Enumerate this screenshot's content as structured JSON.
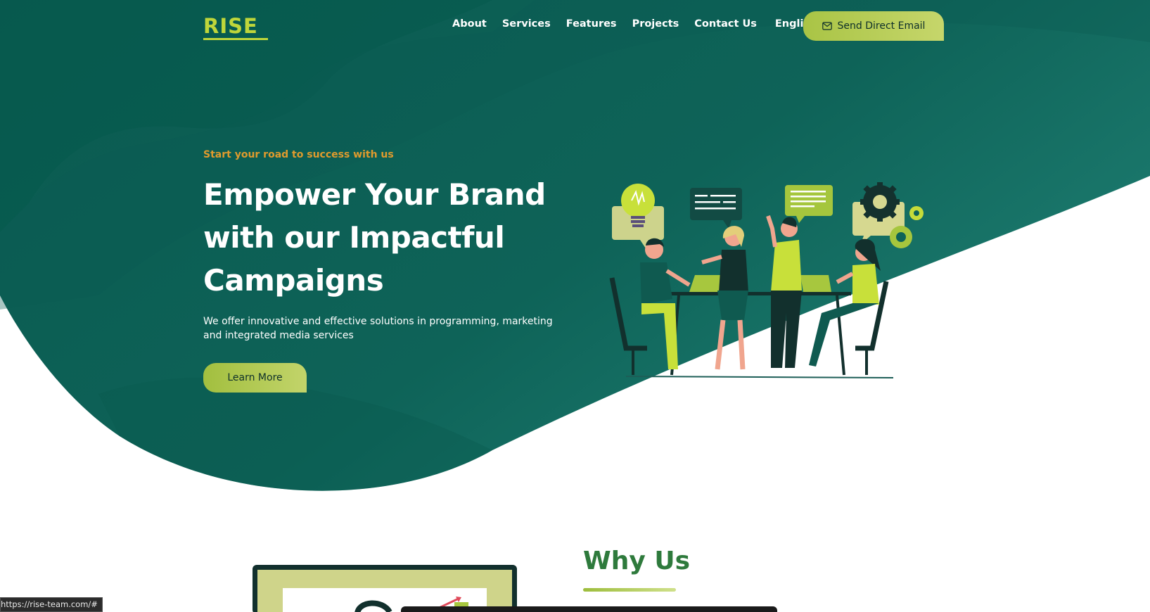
{
  "brand": {
    "logo_text": "RISE"
  },
  "nav": {
    "items": [
      {
        "label": "About"
      },
      {
        "label": "Services"
      },
      {
        "label": "Features"
      },
      {
        "label": "Projects"
      },
      {
        "label": "Contact Us"
      }
    ],
    "language": "English",
    "email_button": "Send Direct Email"
  },
  "hero": {
    "tagline": "Start your road to success with us",
    "headline_line1": "Empower Your Brand",
    "headline_line2": "with our Impactful",
    "headline_line3": "Campaigns",
    "subtext": "We offer innovative and effective solutions in programming, marketing and integrated media services",
    "cta": "Learn More"
  },
  "why": {
    "title": "Why Us"
  },
  "status_bar": {
    "url": "https://rise-team.com/#"
  },
  "colors": {
    "hero_green": "#0e5f55",
    "accent_lime": "#bfd63a",
    "tagline_orange": "#e09b2d",
    "section_title_green": "#2e7a3c"
  },
  "icons": [
    "mail-icon",
    "chevron-down-icon",
    "lightbulb-icon",
    "gear-icon",
    "chat-bubble-icon"
  ]
}
